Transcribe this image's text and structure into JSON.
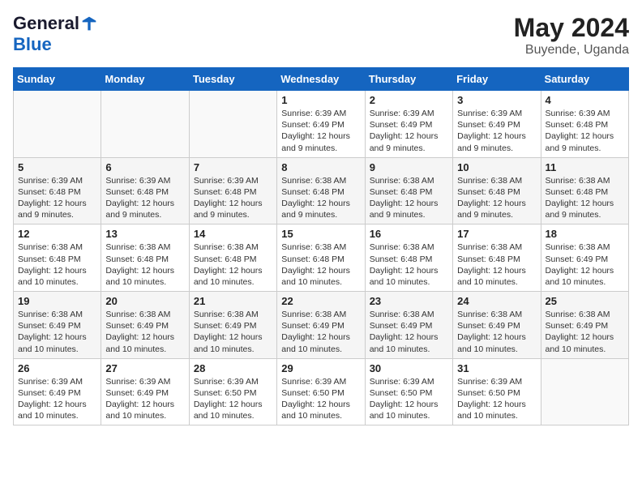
{
  "logo": {
    "general": "General",
    "blue": "Blue"
  },
  "title": {
    "month_year": "May 2024",
    "location": "Buyende, Uganda"
  },
  "days_of_week": [
    "Sunday",
    "Monday",
    "Tuesday",
    "Wednesday",
    "Thursday",
    "Friday",
    "Saturday"
  ],
  "weeks": [
    [
      {
        "day": "",
        "info": ""
      },
      {
        "day": "",
        "info": ""
      },
      {
        "day": "",
        "info": ""
      },
      {
        "day": "1",
        "info": "Sunrise: 6:39 AM\nSunset: 6:49 PM\nDaylight: 12 hours\nand 9 minutes."
      },
      {
        "day": "2",
        "info": "Sunrise: 6:39 AM\nSunset: 6:49 PM\nDaylight: 12 hours\nand 9 minutes."
      },
      {
        "day": "3",
        "info": "Sunrise: 6:39 AM\nSunset: 6:49 PM\nDaylight: 12 hours\nand 9 minutes."
      },
      {
        "day": "4",
        "info": "Sunrise: 6:39 AM\nSunset: 6:48 PM\nDaylight: 12 hours\nand 9 minutes."
      }
    ],
    [
      {
        "day": "5",
        "info": "Sunrise: 6:39 AM\nSunset: 6:48 PM\nDaylight: 12 hours\nand 9 minutes."
      },
      {
        "day": "6",
        "info": "Sunrise: 6:39 AM\nSunset: 6:48 PM\nDaylight: 12 hours\nand 9 minutes."
      },
      {
        "day": "7",
        "info": "Sunrise: 6:39 AM\nSunset: 6:48 PM\nDaylight: 12 hours\nand 9 minutes."
      },
      {
        "day": "8",
        "info": "Sunrise: 6:38 AM\nSunset: 6:48 PM\nDaylight: 12 hours\nand 9 minutes."
      },
      {
        "day": "9",
        "info": "Sunrise: 6:38 AM\nSunset: 6:48 PM\nDaylight: 12 hours\nand 9 minutes."
      },
      {
        "day": "10",
        "info": "Sunrise: 6:38 AM\nSunset: 6:48 PM\nDaylight: 12 hours\nand 9 minutes."
      },
      {
        "day": "11",
        "info": "Sunrise: 6:38 AM\nSunset: 6:48 PM\nDaylight: 12 hours\nand 9 minutes."
      }
    ],
    [
      {
        "day": "12",
        "info": "Sunrise: 6:38 AM\nSunset: 6:48 PM\nDaylight: 12 hours\nand 10 minutes."
      },
      {
        "day": "13",
        "info": "Sunrise: 6:38 AM\nSunset: 6:48 PM\nDaylight: 12 hours\nand 10 minutes."
      },
      {
        "day": "14",
        "info": "Sunrise: 6:38 AM\nSunset: 6:48 PM\nDaylight: 12 hours\nand 10 minutes."
      },
      {
        "day": "15",
        "info": "Sunrise: 6:38 AM\nSunset: 6:48 PM\nDaylight: 12 hours\nand 10 minutes."
      },
      {
        "day": "16",
        "info": "Sunrise: 6:38 AM\nSunset: 6:48 PM\nDaylight: 12 hours\nand 10 minutes."
      },
      {
        "day": "17",
        "info": "Sunrise: 6:38 AM\nSunset: 6:48 PM\nDaylight: 12 hours\nand 10 minutes."
      },
      {
        "day": "18",
        "info": "Sunrise: 6:38 AM\nSunset: 6:49 PM\nDaylight: 12 hours\nand 10 minutes."
      }
    ],
    [
      {
        "day": "19",
        "info": "Sunrise: 6:38 AM\nSunset: 6:49 PM\nDaylight: 12 hours\nand 10 minutes."
      },
      {
        "day": "20",
        "info": "Sunrise: 6:38 AM\nSunset: 6:49 PM\nDaylight: 12 hours\nand 10 minutes."
      },
      {
        "day": "21",
        "info": "Sunrise: 6:38 AM\nSunset: 6:49 PM\nDaylight: 12 hours\nand 10 minutes."
      },
      {
        "day": "22",
        "info": "Sunrise: 6:38 AM\nSunset: 6:49 PM\nDaylight: 12 hours\nand 10 minutes."
      },
      {
        "day": "23",
        "info": "Sunrise: 6:38 AM\nSunset: 6:49 PM\nDaylight: 12 hours\nand 10 minutes."
      },
      {
        "day": "24",
        "info": "Sunrise: 6:38 AM\nSunset: 6:49 PM\nDaylight: 12 hours\nand 10 minutes."
      },
      {
        "day": "25",
        "info": "Sunrise: 6:38 AM\nSunset: 6:49 PM\nDaylight: 12 hours\nand 10 minutes."
      }
    ],
    [
      {
        "day": "26",
        "info": "Sunrise: 6:39 AM\nSunset: 6:49 PM\nDaylight: 12 hours\nand 10 minutes."
      },
      {
        "day": "27",
        "info": "Sunrise: 6:39 AM\nSunset: 6:49 PM\nDaylight: 12 hours\nand 10 minutes."
      },
      {
        "day": "28",
        "info": "Sunrise: 6:39 AM\nSunset: 6:50 PM\nDaylight: 12 hours\nand 10 minutes."
      },
      {
        "day": "29",
        "info": "Sunrise: 6:39 AM\nSunset: 6:50 PM\nDaylight: 12 hours\nand 10 minutes."
      },
      {
        "day": "30",
        "info": "Sunrise: 6:39 AM\nSunset: 6:50 PM\nDaylight: 12 hours\nand 10 minutes."
      },
      {
        "day": "31",
        "info": "Sunrise: 6:39 AM\nSunset: 6:50 PM\nDaylight: 12 hours\nand 10 minutes."
      },
      {
        "day": "",
        "info": ""
      }
    ]
  ]
}
